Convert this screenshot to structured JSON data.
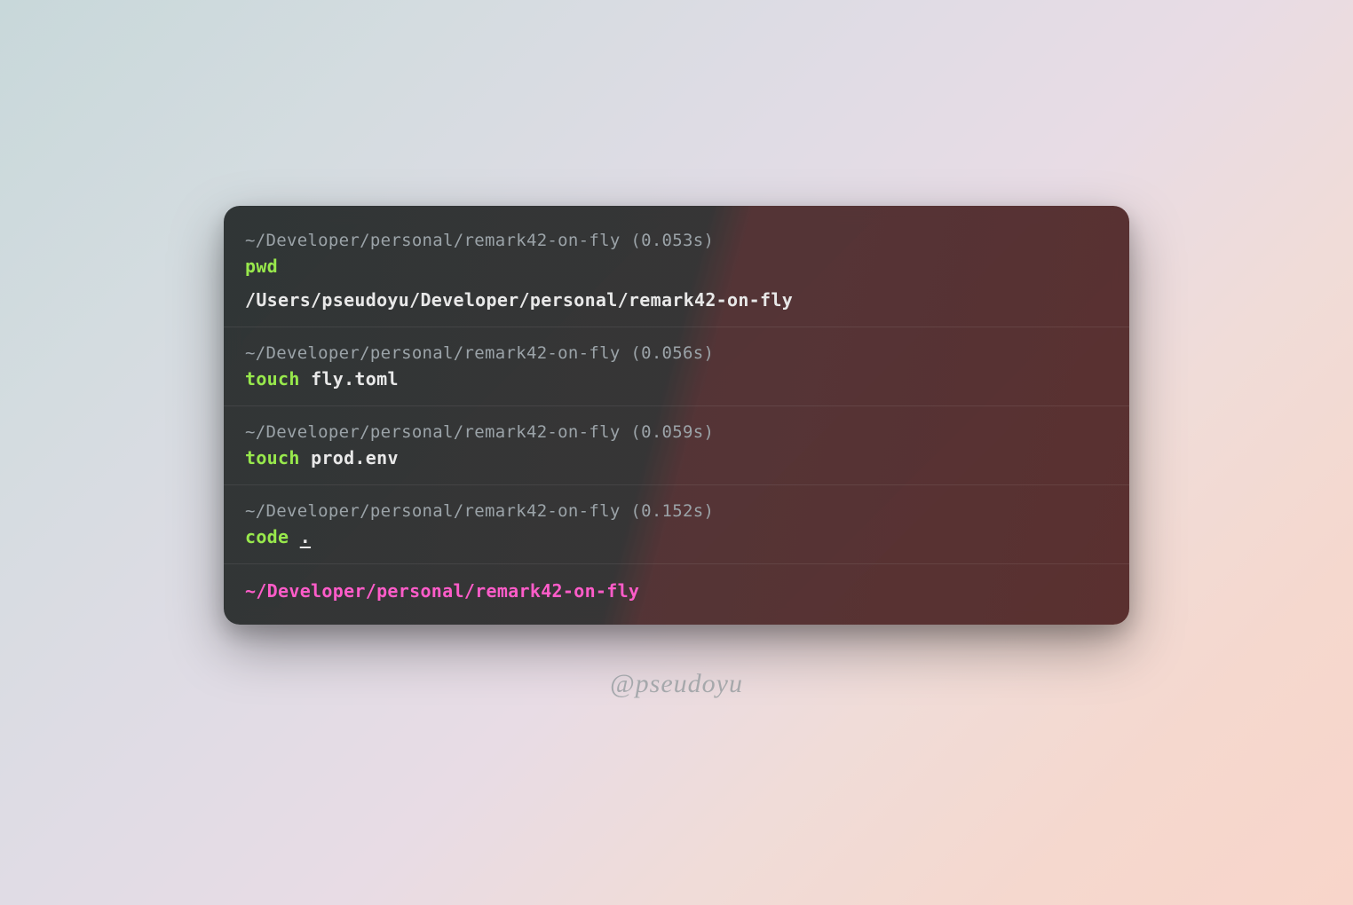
{
  "terminal": {
    "blocks": [
      {
        "path": "~/Developer/personal/remark42-on-fly (0.053s)",
        "keyword": "pwd",
        "arg": "",
        "output": "/Users/pseudoyu/Developer/personal/remark42-on-fly"
      },
      {
        "path": "~/Developer/personal/remark42-on-fly (0.056s)",
        "keyword": "touch",
        "arg": "fly.toml",
        "output": ""
      },
      {
        "path": "~/Developer/personal/remark42-on-fly (0.059s)",
        "keyword": "touch",
        "arg": "prod.env",
        "output": ""
      },
      {
        "path": "~/Developer/personal/remark42-on-fly (0.152s)",
        "keyword": "code",
        "arg": ".",
        "output": ""
      }
    ],
    "current_prompt": "~/Developer/personal/remark42-on-fly"
  },
  "watermark": "@pseudoyu"
}
